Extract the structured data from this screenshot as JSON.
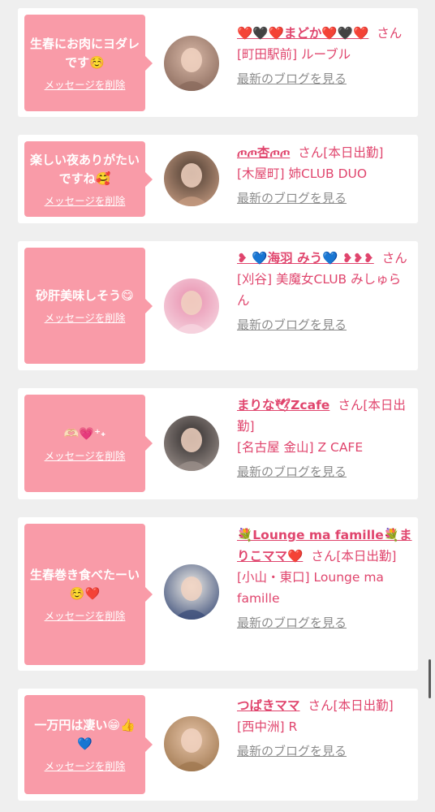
{
  "colors": {
    "bubble": "#f99ba8",
    "accent": "#e0456d",
    "link_gray": "#8c8c8c",
    "background": "#efefef"
  },
  "messages": [
    {
      "message": "生春にお肉にヨダレです☺️",
      "delete_label": "メッセージを削除",
      "name": "❤️🖤❤️まどか❤️🖤❤️",
      "honorific": "さん",
      "shop": "[町田駅前] ルーブル",
      "blog_label": "最新のブログを見る",
      "avatar_icon": "avatar-photo-icon",
      "avatar_colors": [
        "#d9b9a8",
        "#8a6a5c"
      ]
    },
    {
      "message": "楽しい夜ありがたいですね🥰",
      "delete_label": "メッセージを削除",
      "name": "ጦጦ杏ጦጦ",
      "honorific": "さん[本日出勤]",
      "shop": "[木屋町] 姉CLUB DUO",
      "blog_label": "最新のブログを見る",
      "avatar_icon": "avatar-photo-icon",
      "avatar_colors": [
        "#4a3a30",
        "#c49a80"
      ]
    },
    {
      "message": "砂肝美味しそう😋",
      "delete_label": "メッセージを削除",
      "name": "❥ 💙海羽 みう💙 ❥❥❥",
      "honorific": "さん",
      "shop": "[刈谷] 美魔女CLUB みしゅらん",
      "blog_label": "最新のブログを見る",
      "avatar_icon": "avatar-photo-icon",
      "avatar_colors": [
        "#e88fae",
        "#f6d5e0"
      ]
    },
    {
      "message": "🫶🏻💗⁺˖",
      "delete_label": "メッセージを削除",
      "name": "まりな🕊Zcafe",
      "honorific": "さん[本日出勤]",
      "shop": "[名古屋 金山] Z CAFE",
      "blog_label": "最新のブログを見る",
      "avatar_icon": "avatar-photo-icon",
      "avatar_colors": [
        "#2e2a2a",
        "#9a8f8a"
      ]
    },
    {
      "message": "生春巻き食べたーい☺️❤️",
      "delete_label": "メッセージを削除",
      "name": "💐Lounge ma famille💐まりこママ❤️",
      "honorific": "さん[本日出勤]",
      "shop": "[小山・東口] Lounge ma famille",
      "blog_label": "最新のブログを見る",
      "avatar_icon": "avatar-photo-icon",
      "avatar_colors": [
        "#f2efe8",
        "#3d4f7a"
      ]
    },
    {
      "message": "一万円は凄い😁👍💙",
      "delete_label": "メッセージを削除",
      "name": "つばきママ",
      "honorific": "さん[本日出勤]",
      "shop": "[西中洲] R",
      "blog_label": "最新のブログを見る",
      "avatar_icon": "avatar-photo-icon",
      "avatar_colors": [
        "#e6c4a8",
        "#a07850"
      ]
    }
  ]
}
